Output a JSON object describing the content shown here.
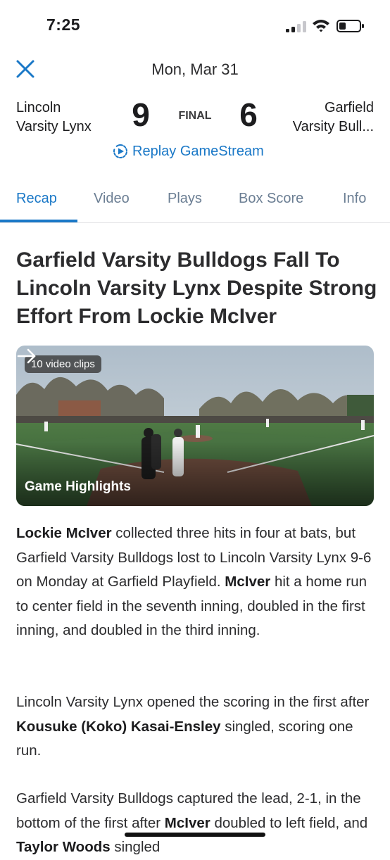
{
  "status_bar": {
    "time": "7:25"
  },
  "header": {
    "date": "Mon, Mar 31",
    "home_team": {
      "line1": "Lincoln",
      "line2": "Varsity Lynx",
      "score": "9"
    },
    "away_team": {
      "line1": "Garfield",
      "line2": "Varsity Bull...",
      "score": "6"
    },
    "status": "FINAL",
    "replay_label": "Replay GameStream"
  },
  "tabs": [
    {
      "label": "Recap",
      "active": true
    },
    {
      "label": "Video",
      "active": false
    },
    {
      "label": "Plays",
      "active": false
    },
    {
      "label": "Box Score",
      "active": false
    },
    {
      "label": "Info",
      "active": false
    }
  ],
  "article": {
    "headline": "Garfield Varsity Bulldogs Fall To Lincoln Varsity Lynx Despite Strong Effort From Lockie McIver",
    "video": {
      "badge": "10 video clips",
      "title": "Game Highlights"
    },
    "paragraphs": [
      {
        "p1_bold1": "Lockie McIver",
        "p1_text1": " collected three hits in four at bats, but Garfield Varsity Bulldogs lost to Lincoln Varsity Lynx 9-6 on Monday at Garfield Playfield. ",
        "p1_bold2": "McIver",
        "p1_text2": " hit a home run to center field in the seventh inning, doubled in the first inning, and doubled in the third inning."
      },
      {
        "p2_text1": "Lincoln Varsity Lynx opened the scoring in the first after ",
        "p2_bold1": "Kousuke (Koko) Kasai-Ensley",
        "p2_text2": " singled, scoring one run."
      },
      {
        "p3_text1": "Garfield Varsity Bulldogs captured the lead, 2-1, in the bottom of the first after ",
        "p3_bold1": "McIver",
        "p3_text2": " doubled to left field, and ",
        "p3_bold2": "Taylor Woods",
        "p3_text3": " singled"
      }
    ]
  },
  "colors": {
    "accent": "#1a78c7",
    "tab_inactive": "#6b7e93",
    "text": "#2c2c2e"
  },
  "icons": [
    "close-icon",
    "replay-icon",
    "arrow-right-icon",
    "signal-icon",
    "wifi-icon",
    "battery-icon"
  ]
}
